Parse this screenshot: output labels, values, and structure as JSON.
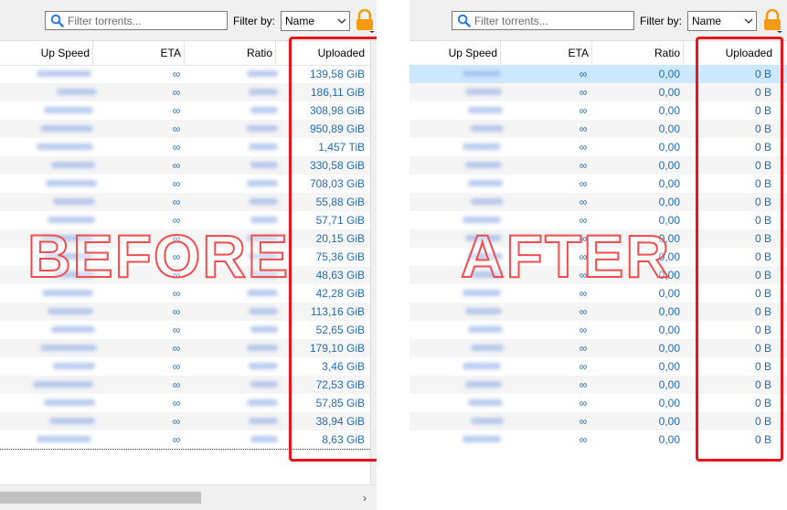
{
  "toolbar": {
    "search_placeholder": "Filter torrents...",
    "filter_label": "Filter by:",
    "filter_value": "Name"
  },
  "columns": {
    "up_speed": "Up Speed",
    "eta": "ETA",
    "ratio": "Ratio",
    "uploaded": "Uploaded"
  },
  "eta_symbol": "∞",
  "before": {
    "overlay": "BEFORE",
    "uploaded": [
      "139,58 GiB",
      "186,11 GiB",
      "308,98 GiB",
      "950,89 GiB",
      "1,457 TiB",
      "330,58 GiB",
      "708,03 GiB",
      "55,88 GiB",
      "57,71 GiB",
      "20,15 GiB",
      "75,36 GiB",
      "48,63 GiB",
      "42,28 GiB",
      "113,16 GiB",
      "52,65 GiB",
      "179,10 GiB",
      "3,46 GiB",
      "72,53 GiB",
      "57,85 GiB",
      "38,94 GiB",
      "8,63 GiB"
    ]
  },
  "after": {
    "overlay": "AFTER",
    "ratio": "0,00",
    "uploaded": "0 B"
  },
  "colors": {
    "accent_red": "#e8141b",
    "link_blue": "#1f6bb5",
    "lock_orange": "#f39c12",
    "selection": "#cce8ff"
  }
}
